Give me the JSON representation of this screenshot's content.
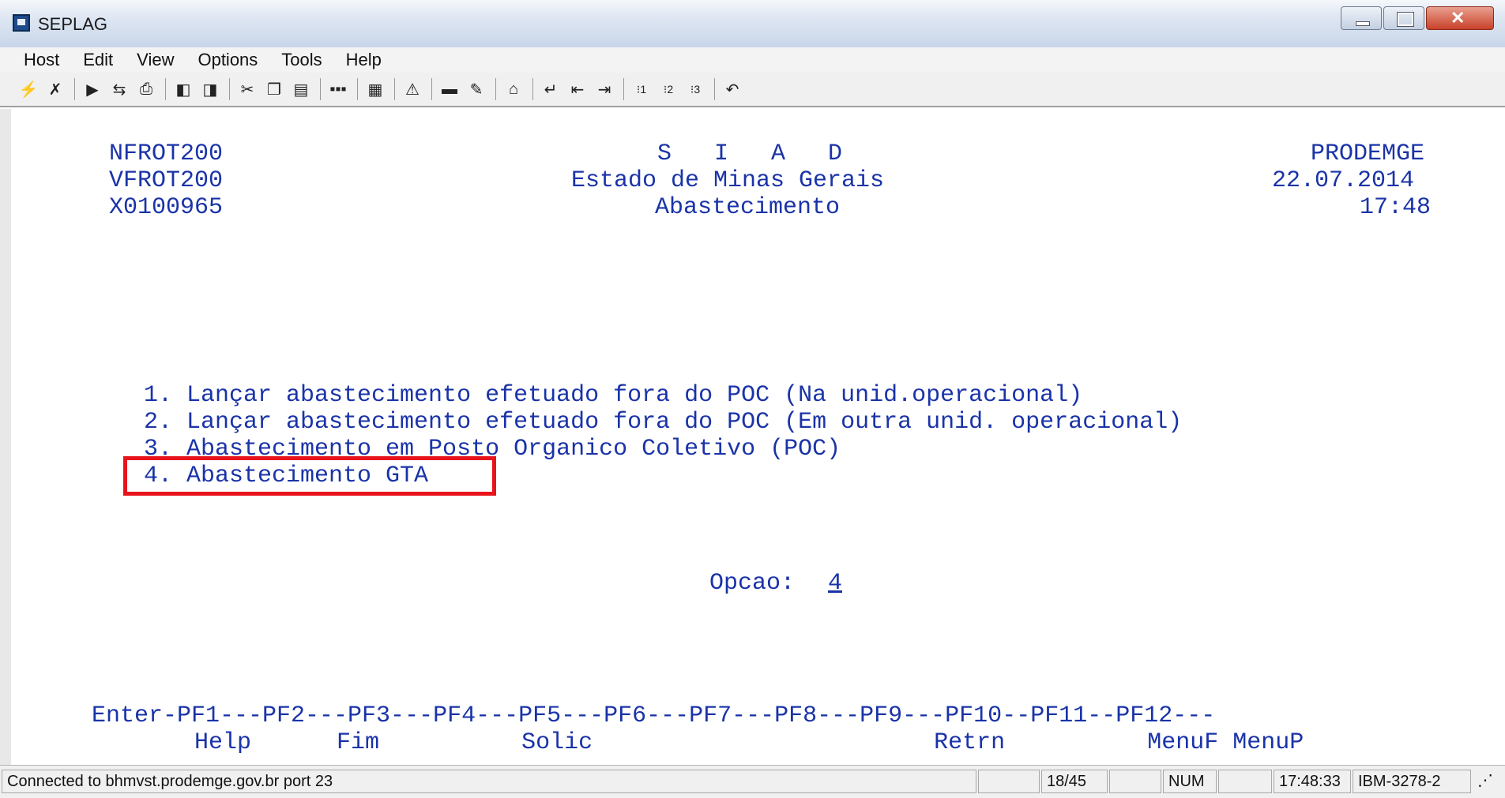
{
  "window": {
    "title": "SEPLAG"
  },
  "menu": [
    "Host",
    "Edit",
    "View",
    "Options",
    "Tools",
    "Help"
  ],
  "toolbar_icons": [
    "connect-icon",
    "disconnect-icon",
    "sep",
    "play-macro-icon",
    "transfer-icon",
    "print-icon",
    "sep",
    "send-icon",
    "receive-icon",
    "sep",
    "cut-icon",
    "copy-icon",
    "paste-icon",
    "sep",
    "keypad-icon",
    "sep",
    "chart-icon",
    "sep",
    "alert-icon",
    "sep",
    "display-icon",
    "edit-icon",
    "sep",
    "home-icon",
    "sep",
    "enter-icon",
    "newline-icon",
    "tab-icon",
    "sep",
    "pa1-icon",
    "pa2-icon",
    "pa3-icon",
    "sep",
    "undo-icon"
  ],
  "screen": {
    "header_left": [
      "NFROT200",
      "VFROT200",
      "X0100965"
    ],
    "header_center": [
      "S   I   A   D",
      "Estado de Minas Gerais",
      "Abastecimento"
    ],
    "header_right": [
      "PRODEMGE",
      "22.07.2014",
      "17:48"
    ],
    "options": [
      "1. Lançar abastecimento efetuado fora do POC (Na unid.operacional)",
      "2. Lançar abastecimento efetuado fora do POC (Em outra unid. operacional)",
      "3. Abastecimento em Posto Organico Coletivo (POC)",
      "4. Abastecimento GTA"
    ],
    "prompt_label": "Opcao:",
    "prompt_value": "4",
    "pf_line": "Enter-PF1---PF2---PF3---PF4---PF5---PF6---PF7---PF8---PF9---PF10--PF11--PF12---",
    "pf_labels": "Help      Fim          Solic                        Retrn          MenuF MenuP"
  },
  "status": {
    "connection": "Connected to bhmvst.prodemge.gov.br port 23",
    "cursor": "18/45",
    "num": "NUM",
    "time": "17:48:33",
    "terminal_type": "IBM-3278-2"
  },
  "colors": {
    "terminal_text": "#1a33a8",
    "highlight": "#e8141c"
  }
}
